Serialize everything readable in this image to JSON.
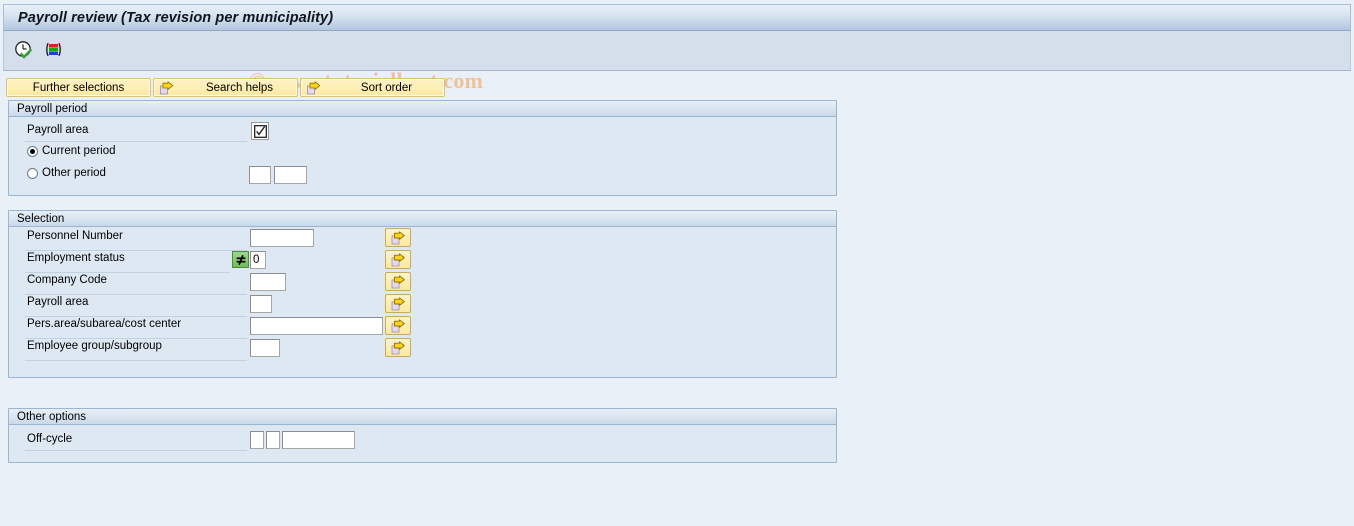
{
  "window": {
    "title": "Payroll review (Tax revision per municipality)"
  },
  "toolbar": {
    "icons": [
      {
        "name": "execute-clock-icon",
        "title": "Execute with variant"
      },
      {
        "name": "variant-layout-icon",
        "title": "Get variant"
      }
    ],
    "watermark": "© www.tutorialkart.com"
  },
  "buttons": [
    {
      "name": "further-selections-button",
      "label": "Further selections",
      "has_arrow": false
    },
    {
      "name": "search-helps-button",
      "label": "Search helps",
      "has_arrow": true
    },
    {
      "name": "sort-order-button",
      "label": "Sort order",
      "has_arrow": true
    }
  ],
  "groups": {
    "payroll_period": {
      "header": "Payroll period",
      "payroll_area": {
        "label": "Payroll area",
        "value": "",
        "matchcode_icon": "checkbox-checked-icon"
      },
      "period_options": [
        {
          "label": "Current period",
          "selected": true
        },
        {
          "label": "Other period",
          "selected": false
        }
      ],
      "other_period_fields": [
        {
          "name": "other-period-field-1",
          "value": ""
        },
        {
          "name": "other-period-field-2",
          "value": ""
        }
      ]
    },
    "selection": {
      "header": "Selection",
      "rows": [
        {
          "name": "personnel-number",
          "label": "Personnel Number",
          "value": "",
          "operator_icon": "",
          "operator_value": "",
          "multi_button": "multiple-selection-arrow-icon"
        },
        {
          "name": "employment-status",
          "label": "Employment status",
          "value": "0",
          "operator_icon": "not-equal-icon",
          "operator_value": "≠",
          "multi_button": "multiple-selection-arrow-icon"
        },
        {
          "name": "company-code",
          "label": "Company Code",
          "value": "",
          "operator_icon": "",
          "operator_value": "",
          "multi_button": "multiple-selection-arrow-icon"
        },
        {
          "name": "payroll-area",
          "label": "Payroll area",
          "value": "",
          "operator_icon": "",
          "operator_value": "",
          "multi_button": "multiple-selection-arrow-icon"
        },
        {
          "name": "pers-area-subarea-cost-center",
          "label": "Pers.area/subarea/cost center",
          "value": "",
          "operator_icon": "",
          "operator_value": "",
          "multi_button": "multiple-selection-arrow-icon"
        },
        {
          "name": "employee-group-subgroup",
          "label": "Employee group/subgroup",
          "value": "",
          "operator_icon": "",
          "operator_value": "",
          "multi_button": "multiple-selection-arrow-icon"
        }
      ]
    },
    "other_options": {
      "header": "Other options",
      "off_cycle": {
        "label": "Off-cycle",
        "fields": [
          {
            "name": "off-cycle-field-1",
            "value": ""
          },
          {
            "name": "off-cycle-field-2",
            "value": ""
          },
          {
            "name": "off-cycle-field-3",
            "value": ""
          }
        ]
      }
    }
  },
  "colors": {
    "titlebar_accent": "#b2c7e0",
    "toolbar_bg": "#d4dfeb",
    "group_bg": "#dee8f2",
    "page_bg": "#eaf0f7",
    "button_yellow": "#fbe79c",
    "operator_green": "#72bd58",
    "watermark": "#f0c193"
  }
}
